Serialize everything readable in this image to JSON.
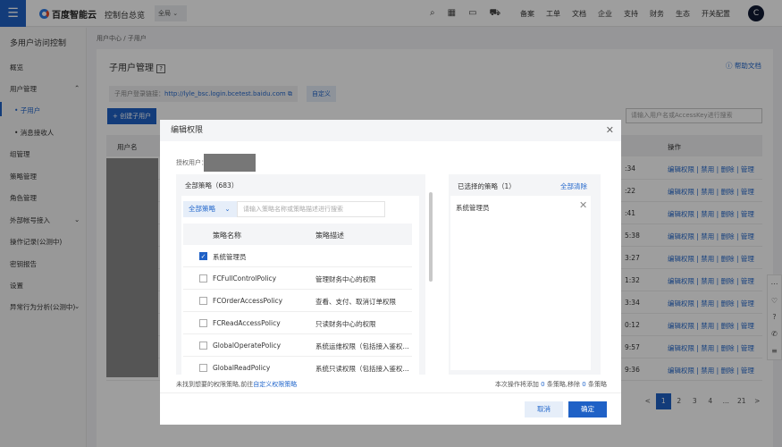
{
  "header": {
    "menu_icon": "☰",
    "brand": "百度智能云",
    "console": "控制台总览",
    "scope": "全局",
    "icons": [
      "search-icon",
      "qr-icon",
      "message-icon",
      "cart-icon"
    ],
    "links": [
      "备案",
      "工单",
      "文档",
      "企业",
      "支持",
      "财务",
      "生态",
      "开关配置"
    ],
    "avatar": "C"
  },
  "sidebar": {
    "title": "多用户访问控制",
    "items": [
      {
        "label": "概览"
      },
      {
        "label": "用户管理",
        "chevron": "⌃"
      },
      {
        "label": "• 子用户",
        "active": true,
        "sub": true
      },
      {
        "label": "• 消息接收人",
        "sub": true
      },
      {
        "label": "组管理"
      },
      {
        "label": "策略管理"
      },
      {
        "label": "角色管理"
      },
      {
        "label": "外部帐号接入",
        "chevron": "⌄"
      },
      {
        "label": "操作记录(公测中)"
      },
      {
        "label": "密钥报告"
      },
      {
        "label": "设置"
      },
      {
        "label": "异常行为分析(公测中)",
        "chevron": "⌄"
      }
    ]
  },
  "breadcrumb": "用户中心 / 子用户",
  "page": {
    "title": "子用户管理",
    "help_icon": "?",
    "help_doc": "ⓘ 帮助文档",
    "login_label": "子用户登录链接：",
    "login_url": "http://lyle_bsc.login.bcetest.baidu.com",
    "customize": "自定义",
    "create": "+ 创建子用户",
    "search_placeholder": "请输入用户名或AccessKey进行搜索"
  },
  "table": {
    "col_user": "用户名",
    "col_ops": "操作",
    "ops": "编辑权限 | 禁用 | 删除 | 管理",
    "times": [
      ":34",
      ":22",
      ":41",
      "5:38",
      "3:27",
      "1:32",
      "3:34",
      "0:12",
      "9:57",
      "9:36"
    ]
  },
  "pagination": {
    "prev": "<",
    "pages": [
      "1",
      "2",
      "3",
      "4",
      "...",
      "21"
    ],
    "next": ">",
    "current": "1"
  },
  "modal": {
    "title": "编辑权限",
    "grant_label": "授权用户：",
    "all_policies": "全部策略（683）",
    "filter": "全部策略",
    "filter_chevron": "⌄",
    "kw_placeholder": "请输入策略名称或策略描述进行搜索",
    "col_name": "策略名称",
    "col_desc": "策略描述",
    "policies": [
      {
        "name": "系统管理员",
        "desc": "",
        "checked": true
      },
      {
        "name": "FCFullControlPolicy",
        "desc": "管理财务中心的权限",
        "checked": false
      },
      {
        "name": "FCOrderAccessPolicy",
        "desc": "查看、支付、取消订单权限",
        "checked": false
      },
      {
        "name": "FCReadAccessPolicy",
        "desc": "只读财务中心的权限",
        "checked": false
      },
      {
        "name": "GlobalOperatePolicy",
        "desc": "系统运维权限（包括接入鉴权...",
        "checked": false
      },
      {
        "name": "GlobalReadPolicy",
        "desc": "系统只读权限（包括接入鉴权...",
        "checked": false
      }
    ],
    "selected_title": "已选择的策略（1）",
    "clear_all": "全部清除",
    "selected": [
      "系统管理员"
    ],
    "not_found": "未找到想要的权限策略,前往",
    "custom_link": "自定义权限策略",
    "summary_a": "本次操作将添加",
    "add_count": "0",
    "summary_b": "条策略,移除",
    "remove_count": "0",
    "summary_c": "条策略",
    "cancel": "取消",
    "ok": "确定"
  }
}
